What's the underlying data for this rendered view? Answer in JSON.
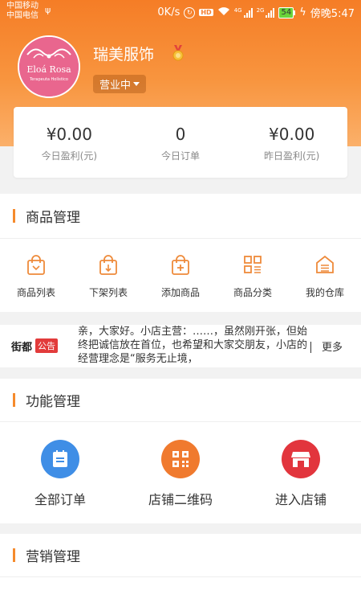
{
  "status_bar": {
    "carrier_1": "中国移动",
    "carrier_2": "中国电信",
    "speed": "0K/s",
    "hd": "HD",
    "network": "4G",
    "network_2": "2G",
    "battery": "54",
    "time": "傍晚5:47"
  },
  "store": {
    "logo_text": "Eloá Rosa",
    "logo_sub": "Terapeuta Holístico",
    "name": "瑞美服饰",
    "status": "营业中"
  },
  "stats": [
    {
      "value": "¥0.00",
      "label": "今日盈利(元)"
    },
    {
      "value": "0",
      "label": "今日订单"
    },
    {
      "value": "¥0.00",
      "label": "昨日盈利(元)"
    }
  ],
  "product_mgmt": {
    "title": "商品管理",
    "items": [
      {
        "label": "商品列表",
        "icon": "bag-icon"
      },
      {
        "label": "下架列表",
        "icon": "bag-down-icon"
      },
      {
        "label": "添加商品",
        "icon": "bag-add-icon"
      },
      {
        "label": "商品分类",
        "icon": "category-grid-icon"
      },
      {
        "label": "我的仓库",
        "icon": "warehouse-icon"
      }
    ]
  },
  "notice": {
    "brand": "街都",
    "tag": "公告",
    "text": "亲，大家好。小店主营：……，虽然刚开张，但始终把诚信放在首位，也希望和大家交朋友，小店的经营理念是“服务无止境，",
    "more": "更多"
  },
  "function_mgmt": {
    "title": "功能管理",
    "items": [
      {
        "label": "全部订单",
        "icon": "orders-icon",
        "color": "#3f8ee6"
      },
      {
        "label": "店铺二维码",
        "icon": "qrcode-icon",
        "color": "#f07a2e"
      },
      {
        "label": "进入店铺",
        "icon": "shop-icon",
        "color": "#e2353d"
      }
    ]
  },
  "marketing_mgmt": {
    "title": "营销管理"
  },
  "colors": {
    "accent": "#f58a2c",
    "header_gradient_top": "#f57d26",
    "header_gradient_bottom": "#fbb06a"
  }
}
